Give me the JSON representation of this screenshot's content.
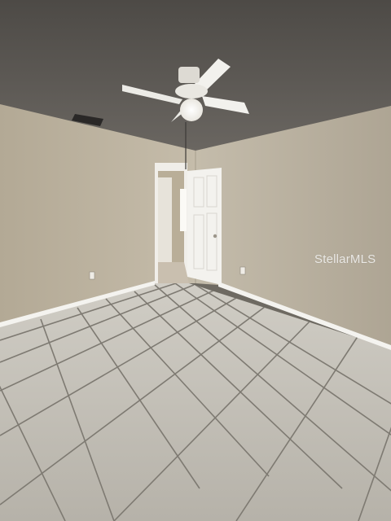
{
  "photo": {
    "subject": "empty-bedroom-interior",
    "watermark": "StellarMLS"
  },
  "colors": {
    "ceiling": "#5f5b56",
    "left_wall": "#c0b6a4",
    "right_wall": "#bcb3a2",
    "floor_tile": "#bfbbb2",
    "grout": "#7e7a72",
    "door": "#f2f1ee",
    "baseboard": "#f4f3ef"
  }
}
